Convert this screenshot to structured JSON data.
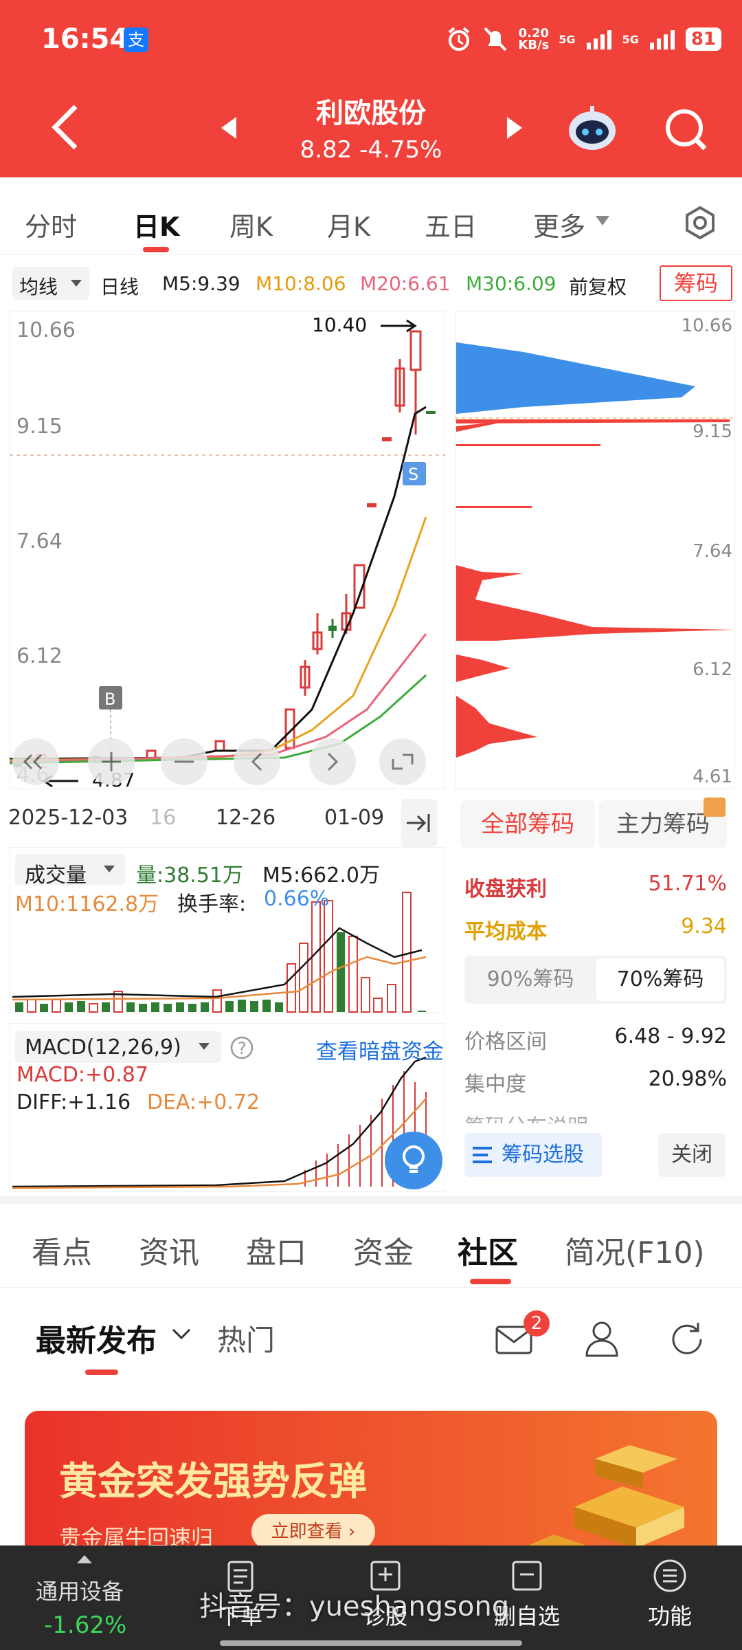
{
  "status": {
    "time": "16:54",
    "net_speed": "0.20\nKB/s",
    "signal1": "5G",
    "signal2": "5G",
    "battery": "81",
    "alipay_icon": "支"
  },
  "stock": {
    "name": "利欧股份",
    "price_change": "8.82 -4.75%"
  },
  "period_tabs": [
    "分时",
    "日K",
    "周K",
    "月K",
    "五日",
    "更多"
  ],
  "ma": {
    "dropdown": "均线",
    "type": "日线",
    "m5": "M5:9.39",
    "m10": "M10:8.06",
    "m20": "M20:6.61",
    "m30": "M30:6.09",
    "adjust": "前复权",
    "chips_btn": "筹码"
  },
  "kline": {
    "y_labels": [
      "10.66",
      "9.15",
      "7.64",
      "6.12",
      "4.6"
    ],
    "high_label": "10.40",
    "low_label": "4.87",
    "buy_marker": "B",
    "sell_marker": "S"
  },
  "dates": {
    "d1": "2025-12-03",
    "d2": "16",
    "d3": "12-26",
    "d4": "01-09"
  },
  "chips": {
    "y_top": "10.66",
    "y_9": "9.15",
    "y_7": "7.64",
    "y_6": "6.12",
    "y_bottom": "4.61",
    "tab_all": "全部筹码",
    "tab_main": "主力筹码",
    "profit_label": "收盘获利",
    "profit_value": "51.71%",
    "cost_label": "平均成本",
    "cost_value": "9.34",
    "chip90": "90%筹码",
    "chip70": "70%筹码",
    "range_label": "价格区间",
    "range_value": "6.48 - 9.92",
    "conc_label": "集中度",
    "conc_value": "20.98%",
    "desc_label": "筹码分布说明",
    "select_btn": "筹码选股",
    "close_btn": "关闭"
  },
  "volume": {
    "dropdown": "成交量",
    "vol": "量:38.51万",
    "m5": "M5:662.0万",
    "m10": "M10:1162.8万",
    "turnover_label": "换手率:",
    "turnover_value": "0.66%"
  },
  "macd": {
    "dropdown": "MACD(12,26,9)",
    "link": "查看暗盘资金",
    "macd": "MACD:+0.87",
    "diff": "DIFF:+1.16",
    "dea": "DEA:+0.72"
  },
  "bottom_tabs": [
    "看点",
    "资讯",
    "盘口",
    "资金",
    "社区",
    "简况(F10)"
  ],
  "feed": {
    "latest": "最新发布",
    "hot": "热门",
    "mail_badge": "2"
  },
  "banner": {
    "title": "黄金突发强势反弹",
    "sub": "贵金属牛回速归",
    "cta": "立即查看 ›"
  },
  "bottom_nav": {
    "sector": "通用设备",
    "sector_change": "-1.62%",
    "order": "下单",
    "diag": "诊股",
    "delete": "删自选",
    "func": "功能",
    "watermark": "抖音号：yueshangsong"
  },
  "colors": {
    "red": "#f0423a",
    "green": "#2e7d32",
    "blue": "#3d8fe8"
  }
}
